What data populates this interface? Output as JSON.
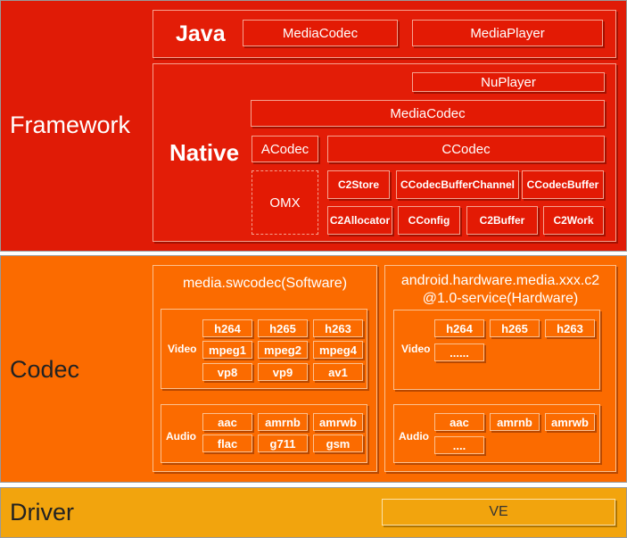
{
  "framework": {
    "label": "Framework",
    "java": {
      "label": "Java",
      "items": [
        "MediaCodec",
        "MediaPlayer"
      ]
    },
    "native": {
      "label": "Native",
      "nuplayer": "NuPlayer",
      "mediacodec": "MediaCodec",
      "acodec": "ACodec",
      "ccodec": "CCodec",
      "omx": "OMX",
      "c2_row1": [
        "C2Store",
        "CCodecBufferChannel",
        "CCodecBuffer"
      ],
      "c2_row2": [
        "C2Allocator",
        "CConfig",
        "C2Buffer",
        "C2Work"
      ]
    }
  },
  "codec": {
    "label": "Codec",
    "software": {
      "title": "media.swcodec(Software)",
      "video_label": "Video",
      "video": [
        "h264",
        "h265",
        "h263",
        "mpeg1",
        "mpeg2",
        "mpeg4",
        "vp8",
        "vp9",
        "av1"
      ],
      "audio_label": "Audio",
      "audio": [
        "aac",
        "amrnb",
        "amrwb",
        "flac",
        "g711",
        "gsm"
      ]
    },
    "hardware": {
      "title_line1": "android.hardware.media.xxx.c2",
      "title_line2": "@1.0-service(Hardware)",
      "video_label": "Video",
      "video": [
        "h264",
        "h265",
        "h263",
        "......"
      ],
      "audio_label": "Audio",
      "audio": [
        "aac",
        "amrnb",
        "amrwb",
        "...."
      ]
    }
  },
  "driver": {
    "label": "Driver",
    "ve": "VE"
  },
  "colors": {
    "framework": "#e01b06",
    "codec": "#fb6b00",
    "driver": "#f2a40d"
  }
}
